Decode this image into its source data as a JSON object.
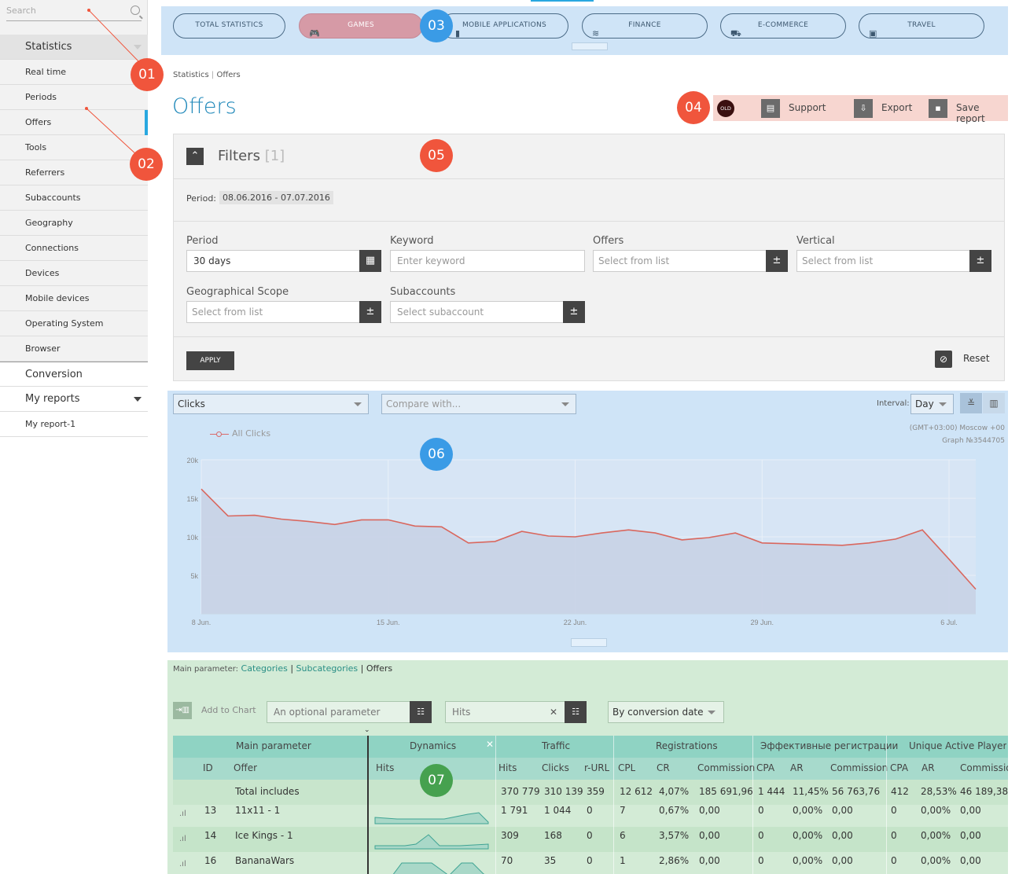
{
  "sidebar": {
    "search_placeholder": "Search",
    "section_statistics": "Statistics",
    "items": [
      "Real time",
      "Periods",
      "Offers",
      "Tools",
      "Referrers",
      "Subaccounts",
      "Geography",
      "Connections",
      "Devices",
      "Mobile devices",
      "Operating System",
      "Browser"
    ],
    "active_item": "Offers",
    "section_conversion": "Conversion",
    "section_my_reports": "My reports",
    "report_items": [
      "My report-1"
    ]
  },
  "topnav": {
    "tabs": [
      {
        "label": "TOTAL STATISTICS",
        "icon": "none"
      },
      {
        "label": "GAMES",
        "icon": "gamepad-icon",
        "active": true
      },
      {
        "label": "MOBILE APPLICATIONS",
        "icon": "phone-icon"
      },
      {
        "label": "FINANCE",
        "icon": "money-icon"
      },
      {
        "label": "E-COMMERCE",
        "icon": "cart-icon"
      },
      {
        "label": "TRAVEL",
        "icon": "suitcase-icon"
      }
    ]
  },
  "breadcrumb": {
    "root": "Statistics",
    "sep": "|",
    "current": "Offers"
  },
  "page_title": "Offers",
  "actions": {
    "old_badge": "OLD",
    "support": "Support",
    "export": "Export",
    "save_report": "Save report"
  },
  "filters": {
    "title": "Filters",
    "count": "[1]",
    "period_label": "Period:",
    "period_value": "08.06.2016 - 07.07.2016",
    "fields": {
      "period": {
        "label": "Period",
        "value": "30 days"
      },
      "keyword": {
        "label": "Keyword",
        "placeholder": "Enter keyword"
      },
      "offers": {
        "label": "Offers",
        "placeholder": "Select from list"
      },
      "vertical": {
        "label": "Vertical",
        "placeholder": "Select from list"
      },
      "geo": {
        "label": "Geographical Scope",
        "placeholder": "Select from list"
      },
      "subaccounts": {
        "label": "Subaccounts",
        "placeholder": "Select subaccount"
      }
    },
    "apply": "APPLY",
    "reset": "Reset"
  },
  "chart_controls": {
    "metric": "Clicks",
    "compare": "Compare with...",
    "interval_label": "Interval:",
    "interval": "Day",
    "timezone": "(GMT+03:00) Moscow +00",
    "graph_id": "Graph №3544705",
    "legend": "All Clicks"
  },
  "chart_data": {
    "type": "area",
    "series": [
      {
        "name": "All Clicks",
        "values": [
          16200,
          12700,
          12800,
          12300,
          12000,
          11600,
          12200,
          12200,
          11400,
          11300,
          9200,
          9400,
          10700,
          10100,
          10000,
          10500,
          10900,
          10500,
          9600,
          9900,
          10500,
          9200,
          9100,
          9000,
          8900,
          9200,
          9700,
          10900,
          7100,
          3200
        ]
      }
    ],
    "x_tick_labels": [
      "8 Jun.",
      "15 Jun.",
      "22 Jun.",
      "29 Jun.",
      "6 Jul."
    ],
    "y_tick_labels": [
      "20k",
      "15k",
      "10k",
      "5k"
    ],
    "ylim": [
      0,
      20000
    ],
    "colors": {
      "line": "#d9675e",
      "fill": "#c8d2e6"
    }
  },
  "table": {
    "main_param_label": "Main parameter:",
    "main_param_links": [
      "Categories",
      "Subcategories"
    ],
    "main_param_current": "Offers",
    "add_to_chart": "Add to Chart",
    "optional_param_placeholder": "An optional parameter",
    "hits_value": "Hits",
    "conversion_sort": "By conversion date",
    "groups": [
      "Main parameter",
      "Dynamics",
      "Traffic",
      "Registrations",
      "Эффективные регистрации",
      "Unique Active Player"
    ],
    "columns": [
      "ID",
      "Offer",
      "Hits",
      "Hits",
      "Clicks",
      "r-URL",
      "CPL",
      "CR",
      "Commission",
      "CPA",
      "AR",
      "Commission",
      "CPA",
      "AR",
      "Commission"
    ],
    "total": {
      "label": "Total includes",
      "hits": "370 779",
      "clicks": "310 139",
      "rurl": "359",
      "cpl": "12 612",
      "cr": "4,07%",
      "commission": "185 691,96",
      "cpa": "1 444",
      "ar": "11,45%",
      "commission2": "56 763,76",
      "cpa2": "412",
      "ar2": "28,53%",
      "commission3": "46 189,38"
    },
    "rows": [
      {
        "id": "13",
        "offer": "11x11 - 1",
        "hits": "1 791",
        "clicks": "1 044",
        "rurl": "0",
        "cpl": "7",
        "cr": "0,67%",
        "commission": "0,00",
        "cpa": "0",
        "ar": "0,00%",
        "commission2": "0,00",
        "cpa2": "0",
        "ar2": "0,00%",
        "commission3": "0,00"
      },
      {
        "id": "14",
        "offer": "Ice Kings - 1",
        "hits": "309",
        "clicks": "168",
        "rurl": "0",
        "cpl": "6",
        "cr": "3,57%",
        "commission": "0,00",
        "cpa": "0",
        "ar": "0,00%",
        "commission2": "0,00",
        "cpa2": "0",
        "ar2": "0,00%",
        "commission3": "0,00"
      },
      {
        "id": "16",
        "offer": "BananaWars",
        "hits": "70",
        "clicks": "35",
        "rurl": "0",
        "cpl": "1",
        "cr": "2,86%",
        "commission": "0,00",
        "cpa": "0",
        "ar": "0,00%",
        "commission2": "0,00",
        "cpa2": "0",
        "ar2": "0,00%",
        "commission3": "0,00"
      }
    ]
  },
  "markers": [
    "01",
    "02",
    "03",
    "04",
    "05",
    "06",
    "07"
  ]
}
